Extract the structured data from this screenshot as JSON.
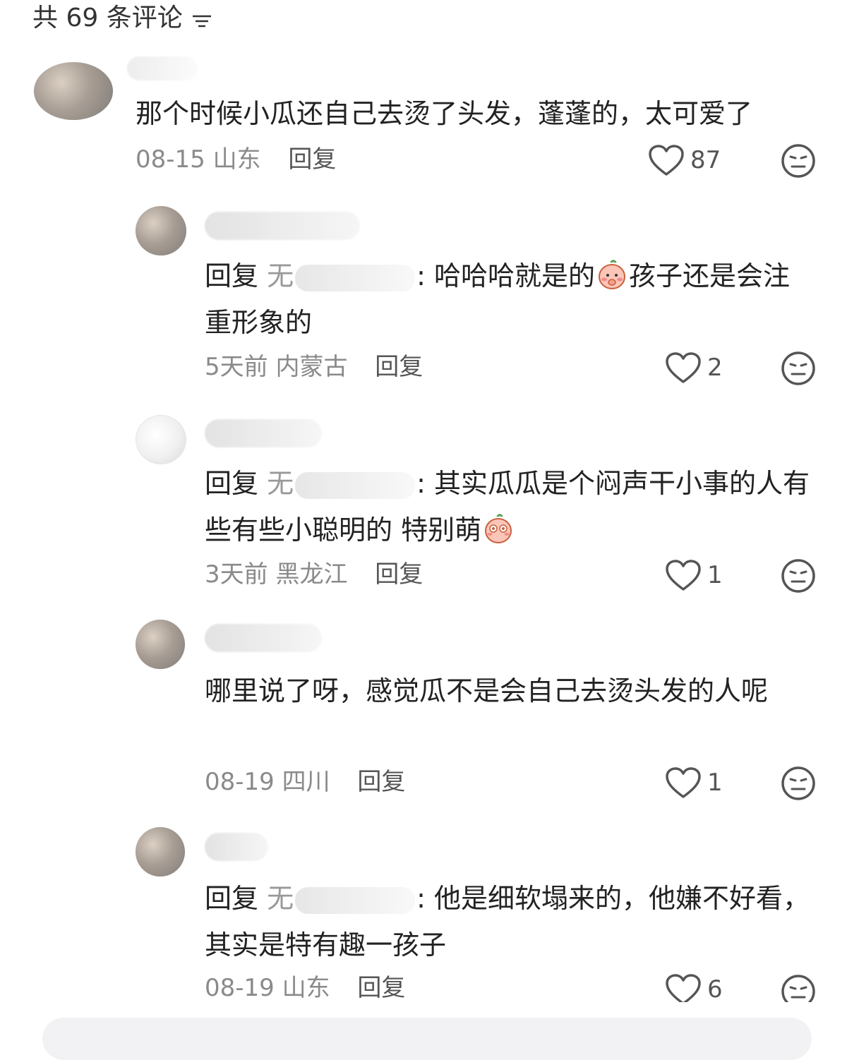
{
  "header": {
    "title": "共 69 条评论",
    "sort_icon": "filter-lines-icon"
  },
  "comments": [
    {
      "text": "那个时候小瓜还自己去烫了头发，蓬蓬的，太可爱了",
      "date": "08-15",
      "location": "山东",
      "reply_label": "回复",
      "likes": "87"
    },
    {
      "reply_prefix": "回复",
      "mention_start": "无",
      "text": ": 哈哈哈就是的",
      "text_after_emoji": "孩子还是会注重形象的",
      "emoji_icon": "blush-peach-emoji",
      "date": "5天前",
      "location": "内蒙古",
      "reply_label": "回复",
      "likes": "2"
    },
    {
      "reply_prefix": "回复",
      "mention_start": "无",
      "text": ": 其实瓜瓜是个闷声干小事的人有些有些小聪明的 特别萌",
      "emoji_icon": "starry-eyes-peach-emoji",
      "date": "3天前",
      "location": "黑龙江",
      "reply_label": "回复",
      "likes": "1"
    },
    {
      "text": "哪里说了呀，感觉瓜不是会自己去烫头发的人呢",
      "date": "08-19",
      "location": "四川",
      "reply_label": "回复",
      "likes": "1"
    },
    {
      "reply_prefix": "回复",
      "mention_start": "无",
      "text": ": 他是细软塌来的，他嫌不好看，其实是特有趣一孩子",
      "date": "08-19",
      "location": "山东",
      "reply_label": "回复",
      "likes": "6"
    }
  ],
  "colors": {
    "text": "#222222",
    "meta": "#8a8a8a",
    "icon": "#555555"
  }
}
